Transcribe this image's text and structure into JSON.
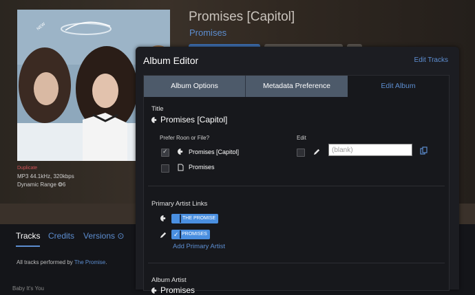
{
  "album": {
    "badge": "NEW",
    "title": "Promises [Capitol]",
    "artist": "Promises",
    "status": "Duplicate",
    "format": "MP3 44.1kHz, 320kbps",
    "dynamic_range": "Dynamic Range  ❂6"
  },
  "bottom_tabs": {
    "tracks": "Tracks",
    "credits": "Credits",
    "versions": "Versions ⊙"
  },
  "performed": {
    "prefix": "All tracks performed by ",
    "artist": "The Promise",
    "suffix": "."
  },
  "track_peek": "Baby It's You",
  "dialog": {
    "title": "Album Editor",
    "edit_tracks": "Edit Tracks",
    "tabs": [
      "Album Options",
      "Metadata Preference",
      "Edit Album"
    ],
    "title_section": {
      "label": "Title",
      "current_value": "Promises [Capitol]",
      "prefer_label": "Prefer Roon or File?",
      "edit_label": "Edit",
      "roon_option": "Promises [Capitol]",
      "file_option": "Promises",
      "edit_placeholder": "(blank)"
    },
    "artist_links": {
      "label": "Primary Artist Links",
      "roon_chip": "THE PROMISE",
      "edit_chip": "PROMISES",
      "add_label": "Add Primary Artist"
    },
    "album_artist": {
      "label": "Album Artist",
      "value": "Promises"
    }
  },
  "colors": {
    "accent": "#5d8ed1",
    "chip": "#4a8fe0",
    "duplicate": "#d4555a",
    "tab_bg": "#4d5a6a"
  }
}
